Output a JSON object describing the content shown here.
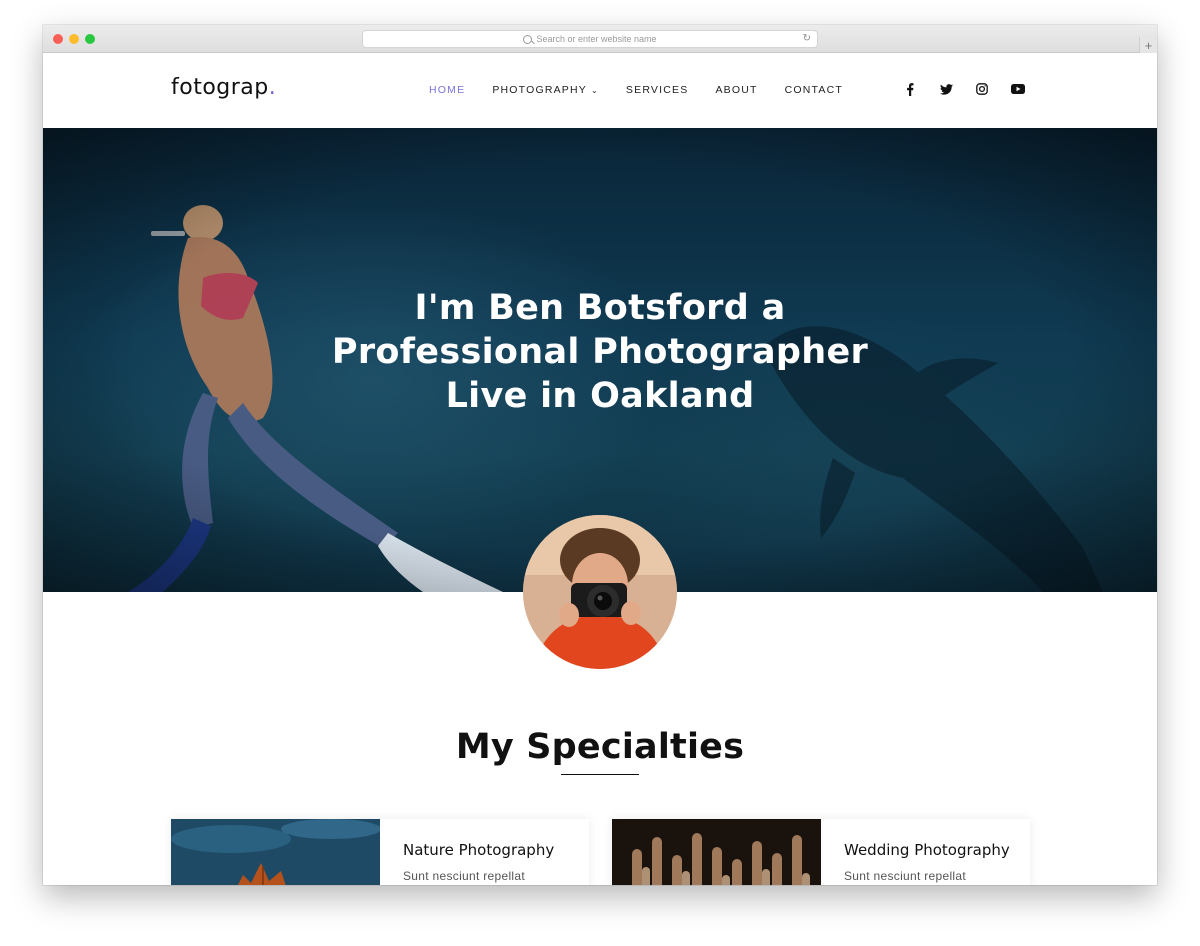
{
  "browser": {
    "url_placeholder": "Search or enter website name",
    "reload_glyph": "↻",
    "newtab_glyph": "+"
  },
  "header": {
    "logo": "fotograp",
    "logo_dot": ".",
    "nav": [
      {
        "label": "HOME",
        "active": true
      },
      {
        "label": "PHOTOGRAPHY",
        "has_dropdown": true
      },
      {
        "label": "SERVICES"
      },
      {
        "label": "ABOUT"
      },
      {
        "label": "CONTACT"
      }
    ],
    "chevron": "⌄",
    "social": [
      "facebook-icon",
      "twitter-icon",
      "instagram-icon",
      "youtube-icon"
    ]
  },
  "hero": {
    "lines": [
      "I'm Ben Botsford a",
      "Professional Photographer",
      "Live in Oakland"
    ]
  },
  "specialties": {
    "title": "My Specialties",
    "cards": [
      {
        "title": "Nature Photography",
        "text": "Sunt nesciunt repellat"
      },
      {
        "title": "Wedding Photography",
        "text": "Sunt nesciunt repellat"
      }
    ]
  },
  "colors": {
    "accent": "#7b74d8",
    "hero_bg": "#0f3a52",
    "text": "#111111"
  }
}
